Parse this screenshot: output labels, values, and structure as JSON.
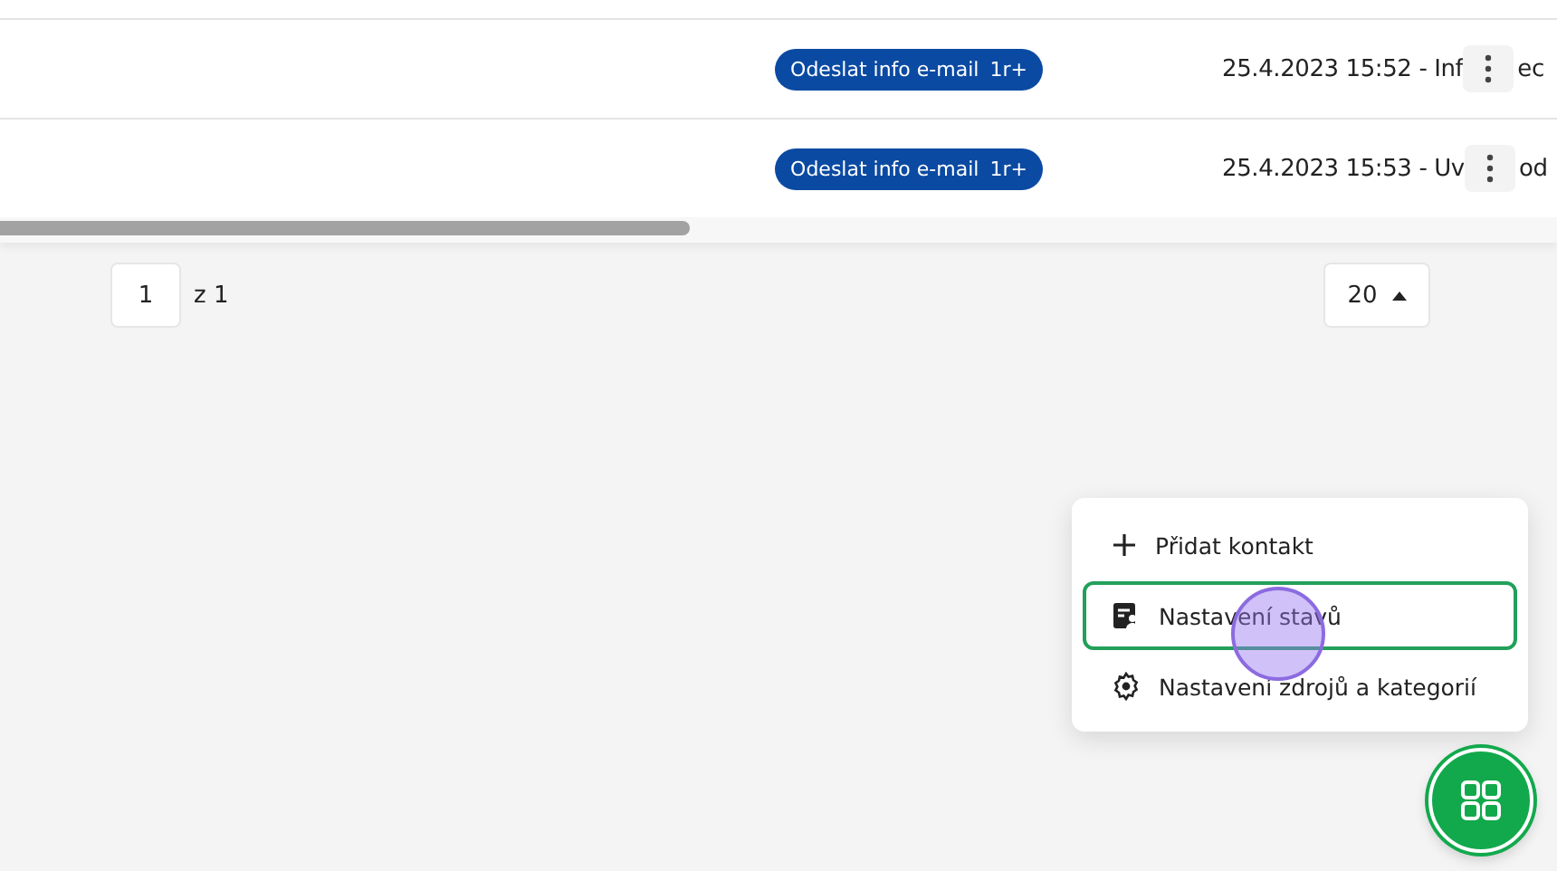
{
  "rows": [
    {
      "badge": "Odeslat info e-mail",
      "badge_count": "1r+",
      "text": "25.4.2023 15:52 - Inf",
      "tail": "ec"
    },
    {
      "badge": "Odeslat info e-mail",
      "badge_count": "1r+",
      "text": "25.4.2023 15:53 - Uv",
      "tail": "od"
    }
  ],
  "pagination": {
    "page": "1",
    "of": "z 1",
    "page_size": "20"
  },
  "menu": {
    "items": [
      {
        "kind": "add",
        "label": "Přidat kontakt",
        "selected": false
      },
      {
        "kind": "states",
        "label": "Nastavení stavů",
        "selected": true
      },
      {
        "kind": "settings",
        "label": "Nastavení zdrojů a kategorií",
        "selected": false
      }
    ]
  }
}
